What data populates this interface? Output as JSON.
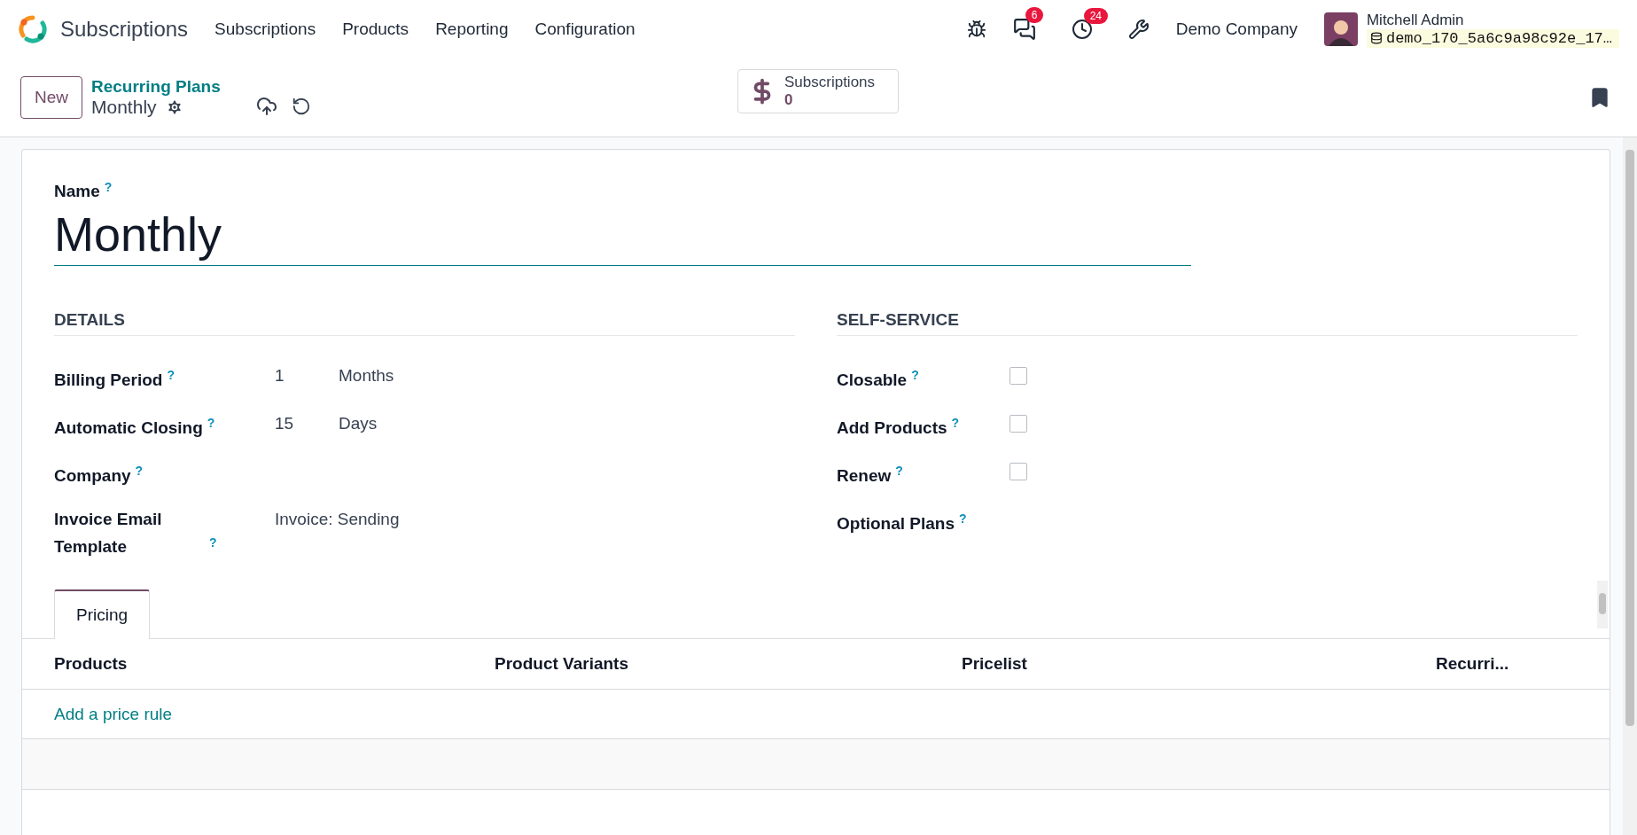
{
  "navbar": {
    "app_name": "Subscriptions",
    "menu": [
      "Subscriptions",
      "Products",
      "Reporting",
      "Configuration"
    ],
    "chat_badge": "6",
    "activity_badge": "24",
    "company": "Demo Company",
    "user": "Mitchell Admin",
    "database": "demo_170_5a6c9a98c92e_17…"
  },
  "control_panel": {
    "new_button": "New",
    "breadcrumb": "Recurring Plans",
    "record": "Monthly",
    "smart_button": {
      "label": "Subscriptions",
      "value": "0"
    }
  },
  "form": {
    "name_label": "Name",
    "name_help": "?",
    "name_value": "Monthly",
    "details": {
      "title": "DETAILS",
      "fields": [
        {
          "label": "Billing Period",
          "help": "?",
          "value": "1",
          "unit": "Months"
        },
        {
          "label": "Automatic Closing",
          "help": "?",
          "value": "15",
          "unit": "Days"
        },
        {
          "label": "Company",
          "help": "?"
        },
        {
          "label": "Invoice Email Template",
          "help": "?",
          "value": "Invoice: Sending"
        }
      ]
    },
    "self_service": {
      "title": "SELF-SERVICE",
      "fields": [
        {
          "label": "Closable",
          "help": "?",
          "kind": "checkbox",
          "checked": false
        },
        {
          "label": "Add Products",
          "help": "?",
          "kind": "checkbox",
          "checked": false
        },
        {
          "label": "Renew",
          "help": "?",
          "kind": "checkbox",
          "checked": false
        },
        {
          "label": "Optional Plans",
          "help": "?",
          "kind": "empty"
        }
      ]
    },
    "tabs": [
      {
        "label": "Pricing",
        "selected": true
      }
    ],
    "table": {
      "columns": [
        "Products",
        "Product Variants",
        "Pricelist",
        "Recurri..."
      ],
      "add_line": "Add a price rule"
    }
  }
}
